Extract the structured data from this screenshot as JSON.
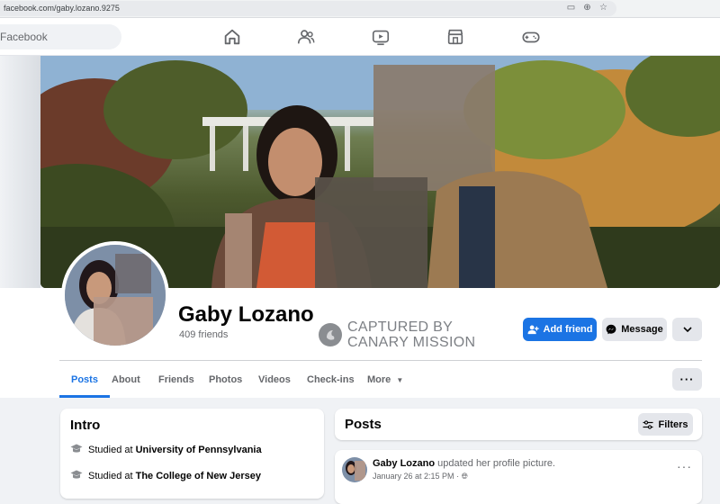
{
  "browser": {
    "url": "facebook.com/gaby.lozano.9275",
    "icons": [
      "cast-icon",
      "zoom-icon",
      "star-icon"
    ]
  },
  "topnav": {
    "search_text": "Facebook",
    "icons": [
      "home-icon",
      "friends-icon",
      "watch-icon",
      "marketplace-icon",
      "gaming-icon"
    ]
  },
  "profile": {
    "name": "Gaby Lozano",
    "friends": "409 friends",
    "add_friend_label": "Add friend",
    "message_label": "Message"
  },
  "stamp": {
    "line1": "CAPTURED BY",
    "line2": "CANARY MISSION"
  },
  "tabs": [
    {
      "label": "Posts",
      "active": true
    },
    {
      "label": "About"
    },
    {
      "label": "Friends"
    },
    {
      "label": "Photos"
    },
    {
      "label": "Videos"
    },
    {
      "label": "Check-ins"
    },
    {
      "label": "More"
    }
  ],
  "intro": {
    "title": "Intro",
    "items": [
      {
        "prefix": "Studied at ",
        "place": "University of Pennsylvania"
      },
      {
        "prefix": "Studied at ",
        "place": "The College of New Jersey"
      }
    ]
  },
  "posts": {
    "title": "Posts",
    "filters_label": "Filters",
    "first_post": {
      "author": "Gaby Lozano",
      "action": "updated her profile picture.",
      "date": "January 26 at 2:15 PM"
    }
  },
  "colors": {
    "accent": "#1b74e4",
    "background": "#f0f2f5"
  }
}
